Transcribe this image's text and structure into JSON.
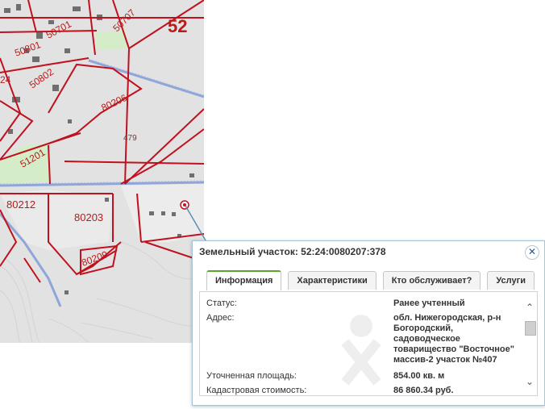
{
  "map": {
    "parcel_labels": [
      "52",
      "50701",
      "50707",
      "50801",
      "50802",
      "24",
      "80206",
      "479",
      "51201",
      "80212",
      "80203",
      "80209"
    ],
    "colors": {
      "boundary": "#c0111f",
      "road": "#8fa6d8",
      "green": "#d5ecc8",
      "background": "#e2e2e2",
      "building": "#6f6f6f"
    },
    "marker_icon": "location-pin-icon"
  },
  "popup": {
    "title": "Земельный участок: 52:24:0080207:378",
    "close_icon": "close-icon",
    "tabs": [
      "Информация",
      "Характеристики",
      "Кто обслуживает?",
      "Услуги"
    ],
    "active_tab": "Информация",
    "rows": [
      {
        "label": "Статус:",
        "value": [
          "Ранее учтенный"
        ]
      },
      {
        "label": "Адрес:",
        "value": [
          "обл. Нижегородская, р-н",
          "Богородский,",
          "садоводческое",
          "товарищество \"Восточное\"",
          "массив-2 участок №407"
        ]
      },
      {
        "label": "Уточненная площадь:",
        "value": [
          "854.00 кв. м"
        ]
      },
      {
        "label": "Кадастровая стоимость:",
        "value": [
          "86 860.34 руб."
        ]
      }
    ]
  }
}
